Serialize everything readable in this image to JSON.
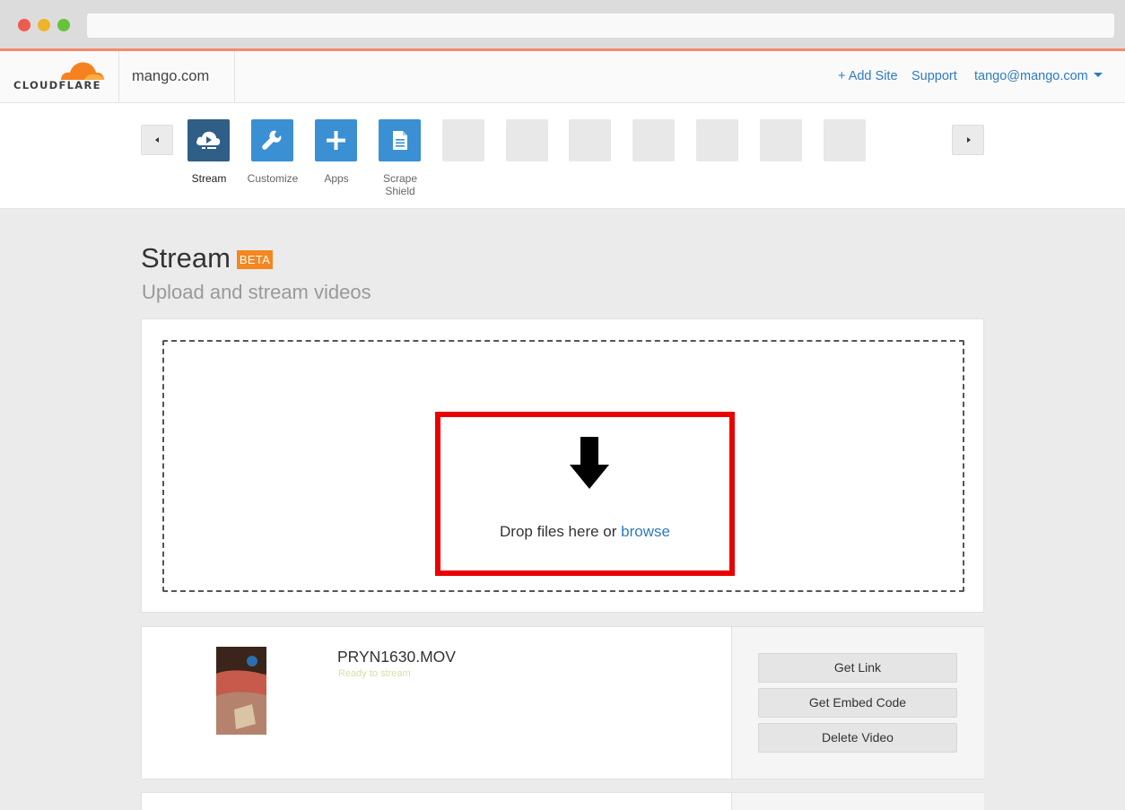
{
  "header": {
    "logo_text": "CLOUDFLARE",
    "site_name": "mango.com",
    "add_site": "+ Add Site",
    "support": "Support",
    "user_email": "tango@mango.com"
  },
  "apps": [
    {
      "label": "Stream",
      "icon": "stream-cloud-icon",
      "active": true
    },
    {
      "label": "Customize",
      "icon": "wrench-icon"
    },
    {
      "label": "Apps",
      "icon": "plus-icon"
    },
    {
      "label": "Scrape\nShield",
      "icon": "document-icon"
    }
  ],
  "page": {
    "title": "Stream",
    "badge": "BETA",
    "subtitle": "Upload and stream videos"
  },
  "upload": {
    "drop_text": "Drop files here or",
    "browse": "browse"
  },
  "videos": [
    {
      "file_name": "PRYN1630.MOV",
      "status": "Ready to stream",
      "actions": {
        "get_link": "Get Link",
        "get_embed": "Get Embed Code",
        "delete": "Delete Video"
      }
    }
  ],
  "colors": {
    "accent_blue": "#3b8fd3",
    "active_tile": "#2f5f86",
    "badge_orange": "#f6861f",
    "highlight_red": "#ea0000",
    "link_blue": "#2f7bbf"
  }
}
